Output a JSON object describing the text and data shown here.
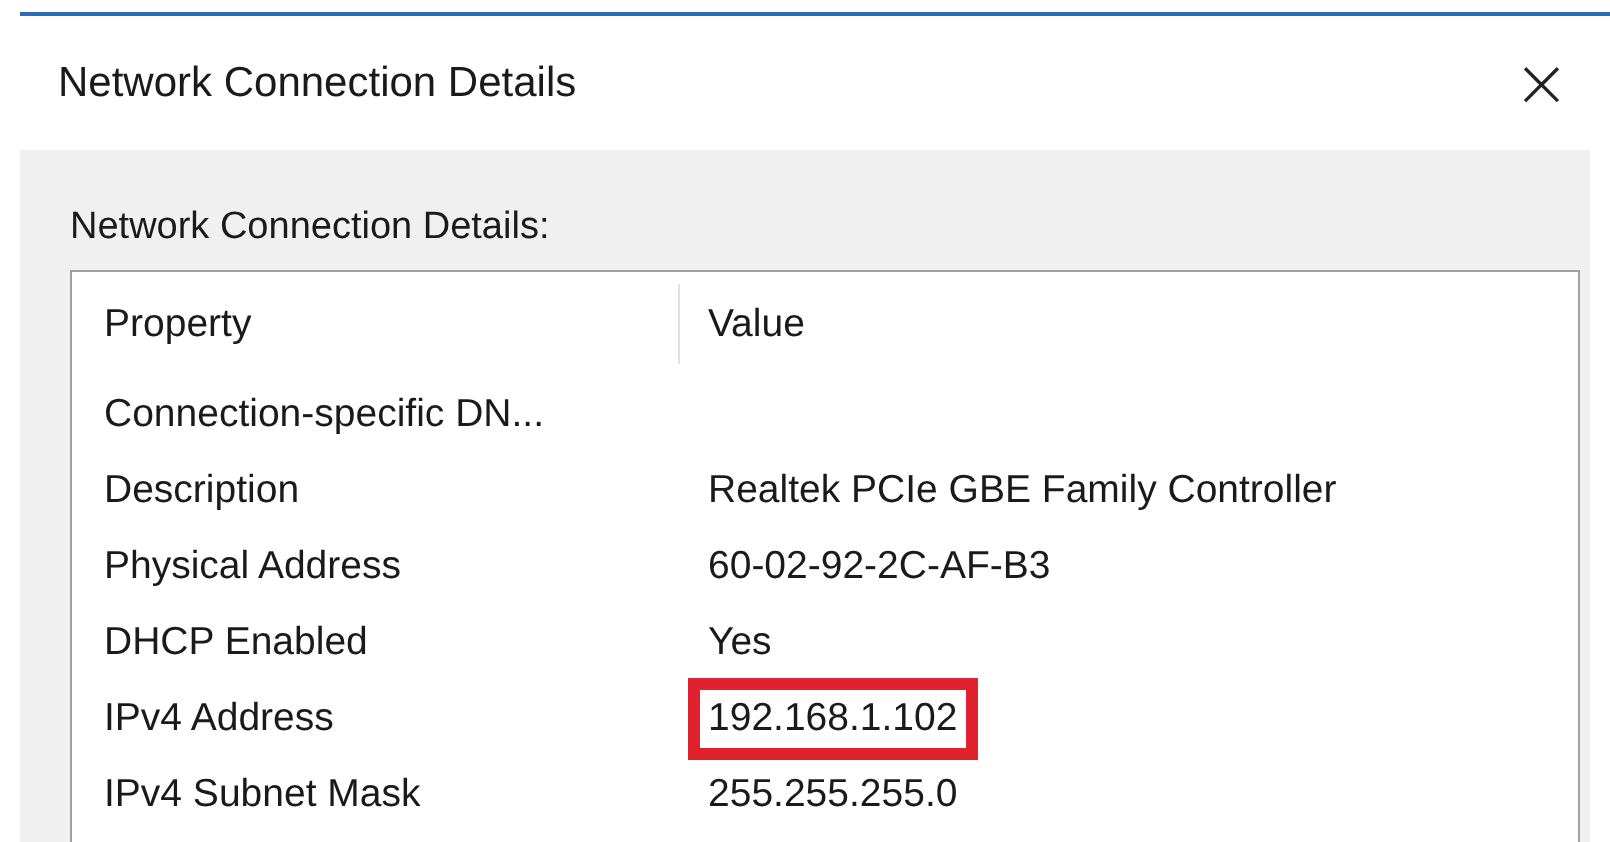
{
  "window": {
    "title": "Network Connection Details",
    "close": "×"
  },
  "label": "Network Connection Details:",
  "table": {
    "columns": [
      "Property",
      "Value"
    ],
    "rows": [
      {
        "property": "Connection-specific DN...",
        "value": "",
        "highlighted": false
      },
      {
        "property": "Description",
        "value": "Realtek PCIe GBE Family Controller",
        "highlighted": false
      },
      {
        "property": "Physical Address",
        "value": "60-02-92-2C-AF-B3",
        "highlighted": false
      },
      {
        "property": "DHCP Enabled",
        "value": "Yes",
        "highlighted": false
      },
      {
        "property": "IPv4 Address",
        "value": "192.168.1.102",
        "highlighted": true
      },
      {
        "property": "IPv4 Subnet Mask",
        "value": "255.255.255.0",
        "highlighted": false
      }
    ]
  }
}
